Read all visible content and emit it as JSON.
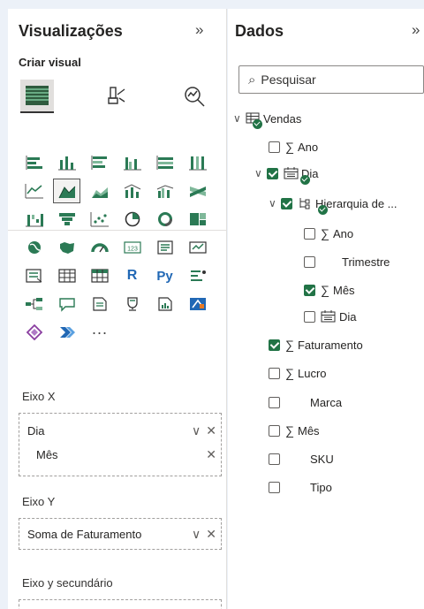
{
  "viz_pane": {
    "title": "Visualizações",
    "subtitle": "Criar visual",
    "more_label": "···",
    "big_tools": [
      "build-visual-icon",
      "format-visual-icon",
      "analytics-icon"
    ]
  },
  "fields": {
    "x_axis": {
      "label": "Eixo X",
      "items": [
        "Dia",
        "Mês"
      ]
    },
    "y_axis": {
      "label": "Eixo Y",
      "items": [
        "Soma de Faturamento"
      ]
    },
    "secondary_y": {
      "label": "Eixo y secundário"
    }
  },
  "data_pane": {
    "title": "Dados",
    "search_placeholder": "Pesquisar",
    "table": "Vendas",
    "rows": [
      {
        "label": "Ano",
        "checked": false,
        "sigma": true
      },
      {
        "label": "Dia",
        "checked": true,
        "sigma": false
      },
      {
        "label": "Hierarquia de ...",
        "checked": true,
        "sigma": false
      },
      {
        "label": "Ano",
        "checked": false,
        "sigma": true
      },
      {
        "label": "Trimestre",
        "checked": false,
        "sigma": false
      },
      {
        "label": "Mês",
        "checked": true,
        "sigma": true
      },
      {
        "label": "Dia",
        "checked": false,
        "sigma": false
      },
      {
        "label": "Faturamento",
        "checked": true,
        "sigma": true
      },
      {
        "label": "Lucro",
        "checked": false,
        "sigma": true
      },
      {
        "label": "Marca",
        "checked": false,
        "sigma": false
      },
      {
        "label": "Mês",
        "checked": false,
        "sigma": true
      },
      {
        "label": "SKU",
        "checked": false,
        "sigma": false
      },
      {
        "label": "Tipo",
        "checked": false,
        "sigma": false
      }
    ]
  },
  "colors": {
    "accent_green": "#217346",
    "pane_bg": "#ffffff",
    "app_bg": "#ecf1f8"
  }
}
